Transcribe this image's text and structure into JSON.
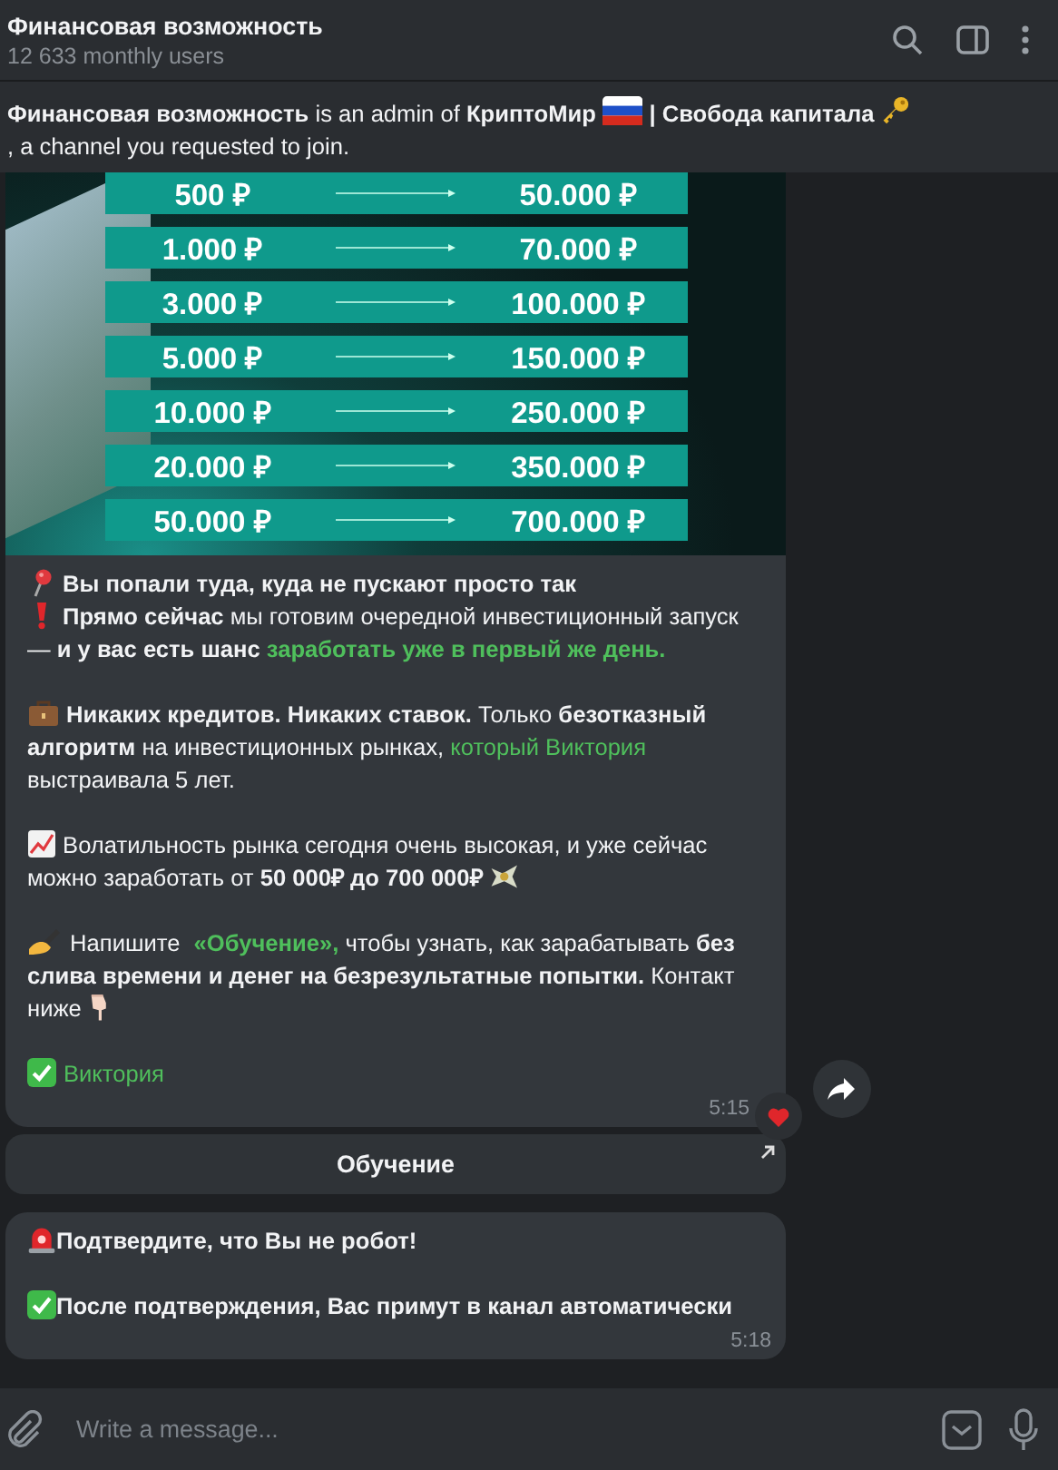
{
  "header": {
    "title": "Финансовая возможность",
    "subtitle": "12 633 monthly users"
  },
  "notice": {
    "lines": [
      [
        {
          "kind": "bold",
          "text": "Финансовая возможность"
        },
        {
          "kind": "plain",
          "text": " is an admin of "
        },
        {
          "kind": "bold",
          "text": "КриптоМир "
        },
        {
          "kind": "flag"
        },
        {
          "kind": "bold",
          "text": " | Свобода капитала "
        },
        {
          "kind": "key"
        }
      ],
      [
        {
          "kind": "plain",
          "text": ", a channel you requested to join."
        }
      ]
    ]
  },
  "messages": [
    {
      "image": {
        "rows": [
          {
            "from": "500 ₽",
            "to": "50.000 ₽"
          },
          {
            "from": "1.000 ₽",
            "to": "70.000 ₽"
          },
          {
            "from": "3.000 ₽",
            "to": "100.000 ₽"
          },
          {
            "from": "5.000 ₽",
            "to": "150.000 ₽"
          },
          {
            "from": "10.000 ₽",
            "to": "250.000 ₽"
          },
          {
            "from": "20.000 ₽",
            "to": "350.000 ₽"
          },
          {
            "from": "50.000 ₽",
            "to": "700.000 ₽"
          }
        ]
      },
      "blocks": [
        [
          [
            {
              "kind": "pin"
            },
            {
              "kind": "bold",
              "text": " Вы попали туда, куда не пускают просто так"
            }
          ],
          [
            {
              "kind": "alert"
            },
            {
              "kind": "bold",
              "text": " Прямо сейчас"
            },
            {
              "kind": "plain",
              "text": " мы готовим очередной инвестиционный запуск — "
            },
            {
              "kind": "bold",
              "text": "и у вас есть шанс "
            },
            {
              "kind": "bold-link",
              "text": "заработать уже в первый же день."
            }
          ]
        ],
        [
          [
            {
              "kind": "briefcase"
            },
            {
              "kind": "bold",
              "text": " Никаких кредитов. Никаких ставок."
            },
            {
              "kind": "plain",
              "text": " Только "
            },
            {
              "kind": "bold",
              "text": "безотказный алгоритм"
            },
            {
              "kind": "plain",
              "text": " на инвестиционных рынках, "
            },
            {
              "kind": "link",
              "text": "который Виктория"
            },
            {
              "kind": "plain",
              "text": " выстраивала 5 лет."
            }
          ]
        ],
        [
          [
            {
              "kind": "chart"
            },
            {
              "kind": "plain",
              "text": " Волатильность рынка сегодня очень высокая, и уже сейчас можно заработать от "
            },
            {
              "kind": "bold",
              "text": "50  000₽ до 700 000₽ "
            },
            {
              "kind": "money"
            }
          ]
        ],
        [
          [
            {
              "kind": "writing"
            },
            {
              "kind": "plain",
              "text": " Напишите "
            },
            {
              "kind": "bold-link",
              "text": "«Обучение»,"
            },
            {
              "kind": "plain",
              "text": " чтобы узнать, как зарабатывать "
            },
            {
              "kind": "bold",
              "text": "без слива времени и денег на безрезультатные попытки."
            },
            {
              "kind": "plain",
              "text": " Контакт ниже "
            },
            {
              "kind": "pointing"
            }
          ]
        ],
        [
          [
            {
              "kind": "check"
            },
            {
              "kind": "link",
              "text": "Виктория"
            }
          ]
        ]
      ],
      "time": "5:15",
      "reaction": {
        "kind": "heart"
      },
      "forward_button": true,
      "buttons": [
        {
          "label": "Обучение",
          "kind": "url"
        }
      ]
    },
    {
      "blocks": [
        [
          [
            {
              "kind": "siren"
            },
            {
              "kind": "bold",
              "text": "Подтвердите, что Вы не робот!"
            }
          ]
        ],
        [
          [
            {
              "kind": "check"
            },
            {
              "kind": "bold",
              "text": "После подтверждения, Вас примут в канал автоматически"
            }
          ]
        ]
      ],
      "time": "5:18",
      "forward_button": false
    }
  ],
  "composer": {
    "placeholder": "Write a message..."
  }
}
